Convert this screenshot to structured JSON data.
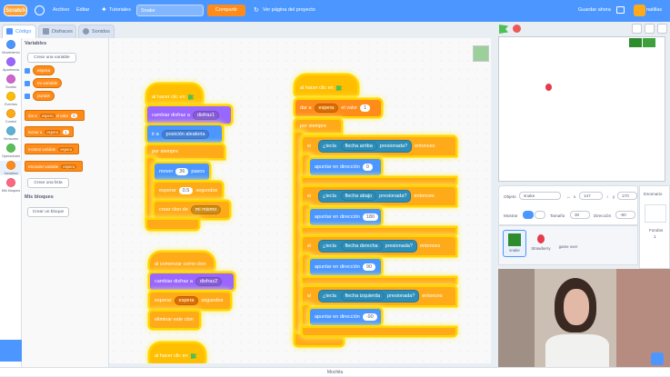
{
  "menubar": {
    "logo": "Scratch",
    "archivo": "Archivo",
    "editar": "Editar",
    "tutoriales": "Tutoriales",
    "project_title": "Snake",
    "share": "Compartir",
    "see_project": "Ver página del proyecto",
    "save_now": "Guardar ahora",
    "username": "natillas"
  },
  "tabs": {
    "code": "Código",
    "costumes": "Disfraces",
    "sounds": "Sonidos"
  },
  "categories": [
    "Movimiento",
    "Apariencia",
    "Sonido",
    "Eventos",
    "Control",
    "Sensores",
    "Operadores",
    "Variables",
    "Mis bloques"
  ],
  "category_colors": [
    "#4c97ff",
    "#9966ff",
    "#cf63cf",
    "#ffbf00",
    "#ffab19",
    "#5cb1d6",
    "#59c059",
    "#ff8c1a",
    "#ff6680"
  ],
  "palette": {
    "variables_title": "Variables",
    "create_variable": "Crear una variable",
    "variables": [
      "espera",
      "mi variable",
      "puntos"
    ],
    "blocks": [
      {
        "label": "dar a",
        "dd": "espera",
        "mid": "el valor",
        "val": "0"
      },
      {
        "label": "sumar a",
        "dd": "espera",
        "mid": "",
        "val": "1"
      },
      {
        "label": "mostrar variable",
        "dd": "espera",
        "mid": "",
        "val": ""
      },
      {
        "label": "esconder variable",
        "dd": "espera",
        "mid": "",
        "val": ""
      }
    ],
    "create_list": "Crear una lista",
    "my_blocks_title": "Mis bloques",
    "create_block": "Crear un bloque"
  },
  "script1": {
    "hat": "al hacer clic en",
    "switch_costume": "cambiar disfraz a",
    "costume": "disfraz1",
    "goto": "ir a",
    "goto_target": "posición aleatoria",
    "forever": "por siempre",
    "move": "mover",
    "move_val": "36",
    "move_unit": "pasos",
    "wait": "esperar",
    "wait_val": "0.5",
    "wait_unit": "segundos",
    "clone": "crear clon de",
    "clone_target": "mi mismo"
  },
  "script2": {
    "hat": "al comenzar como clon",
    "switch_costume": "cambiar disfraz a",
    "costume": "disfraz2",
    "wait": "esperar",
    "wait_var": "espera",
    "wait_unit": "segundos",
    "delete": "eliminar este clon"
  },
  "script3": {
    "hat": "al hacer clic en"
  },
  "script4": {
    "hat": "al hacer clic en",
    "set": "dar a",
    "set_var": "espera",
    "set_mid": "el valor",
    "set_val": "1",
    "forever": "por siempre",
    "if": "si",
    "then": "entonces",
    "key_prefix": "¿tecla",
    "pressed": "presionada?",
    "point": "apuntar en dirección",
    "ifs": [
      {
        "key": "flecha arriba",
        "dir": "0"
      },
      {
        "key": "flecha abajo",
        "dir": "180"
      },
      {
        "key": "flecha derecha",
        "dir": "90"
      },
      {
        "key": "flecha izquierda",
        "dir": "-90"
      }
    ]
  },
  "sprite_info": {
    "sprite_label": "Objeto",
    "sprite_name": "snake",
    "x_label": "x",
    "x": "147",
    "y_label": "y",
    "y": "170",
    "show_label": "Mostrar",
    "size_label": "Tamaño",
    "size": "30",
    "direction_label": "Dirección",
    "direction": "-90"
  },
  "sprites": [
    "snake",
    "Strawberry",
    "game over"
  ],
  "stage_panel": {
    "title": "Escenario",
    "backdrops_label": "Fondos",
    "backdrops_count": "1"
  },
  "backpack": "Mochila"
}
